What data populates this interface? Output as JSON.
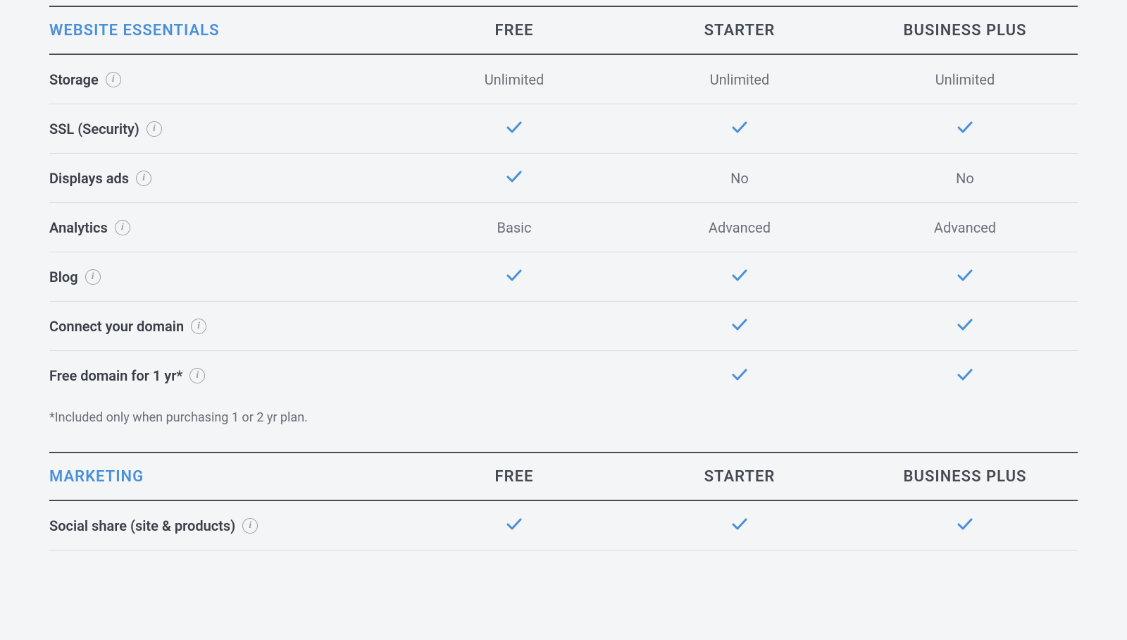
{
  "columns": [
    "FREE",
    "STARTER",
    "BUSINESS PLUS"
  ],
  "sections": [
    {
      "title": "WEBSITE ESSENTIALS",
      "rows": [
        {
          "label": "Storage",
          "info": true,
          "cells": [
            "Unlimited",
            "Unlimited",
            "Unlimited"
          ]
        },
        {
          "label": "SSL (Security)",
          "info": true,
          "cells": [
            "check",
            "check",
            "check"
          ]
        },
        {
          "label": "Displays ads",
          "info": true,
          "cells": [
            "check",
            "No",
            "No"
          ]
        },
        {
          "label": "Analytics",
          "info": true,
          "cells": [
            "Basic",
            "Advanced",
            "Advanced"
          ]
        },
        {
          "label": "Blog",
          "info": true,
          "cells": [
            "check",
            "check",
            "check"
          ]
        },
        {
          "label": "Connect your domain",
          "info": true,
          "cells": [
            "",
            "check",
            "check"
          ]
        },
        {
          "label": "Free domain for 1 yr*",
          "info": true,
          "cells": [
            "",
            "check",
            "check"
          ]
        }
      ],
      "footnote": "*Included only when purchasing 1 or 2 yr plan."
    },
    {
      "title": "MARKETING",
      "rows": [
        {
          "label": "Social share (site & products)",
          "info": true,
          "cells": [
            "check",
            "check",
            "check"
          ]
        }
      ]
    }
  ]
}
